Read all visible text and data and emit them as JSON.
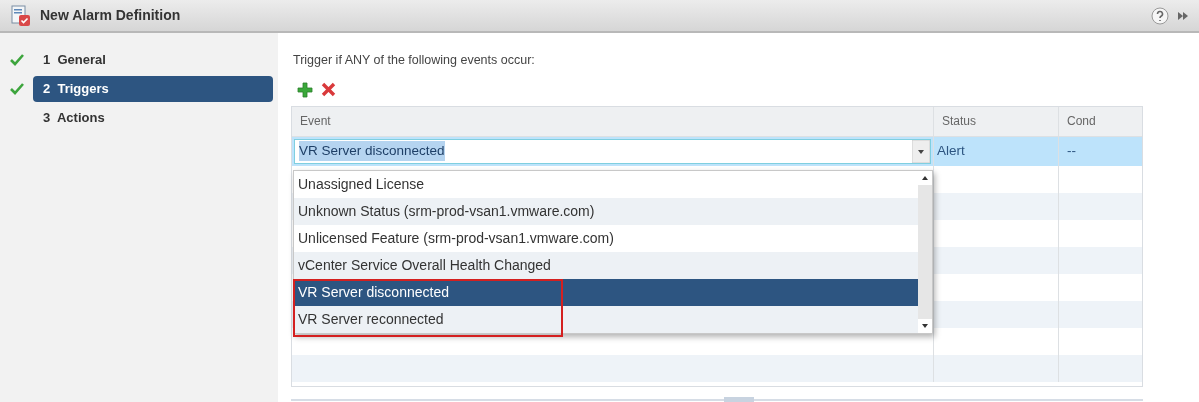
{
  "window": {
    "title": "New Alarm Definition"
  },
  "steps": [
    {
      "label": "1  General",
      "done": true,
      "selected": false
    },
    {
      "label": "2  Triggers",
      "done": true,
      "selected": true
    },
    {
      "label": "3  Actions",
      "done": false,
      "selected": false
    }
  ],
  "heading": "Trigger if ANY of the following events occur:",
  "table": {
    "columns": [
      "Event",
      "Status",
      "Cond"
    ],
    "rows": [
      {
        "event": "VR Server disconnected",
        "status": "Alert",
        "cond": "--",
        "selected": true
      }
    ]
  },
  "dropdown": {
    "items": [
      {
        "label": "Unassigned License",
        "selected": false
      },
      {
        "label": "Unknown Status (srm-prod-vsan1.vmware.com)",
        "selected": false
      },
      {
        "label": "Unlicensed Feature (srm-prod-vsan1.vmware.com)",
        "selected": false
      },
      {
        "label": "vCenter Service Overall Health Changed",
        "selected": false
      },
      {
        "label": "VR Server disconnected",
        "selected": true
      },
      {
        "label": "VR Server reconnected",
        "selected": false
      }
    ]
  }
}
